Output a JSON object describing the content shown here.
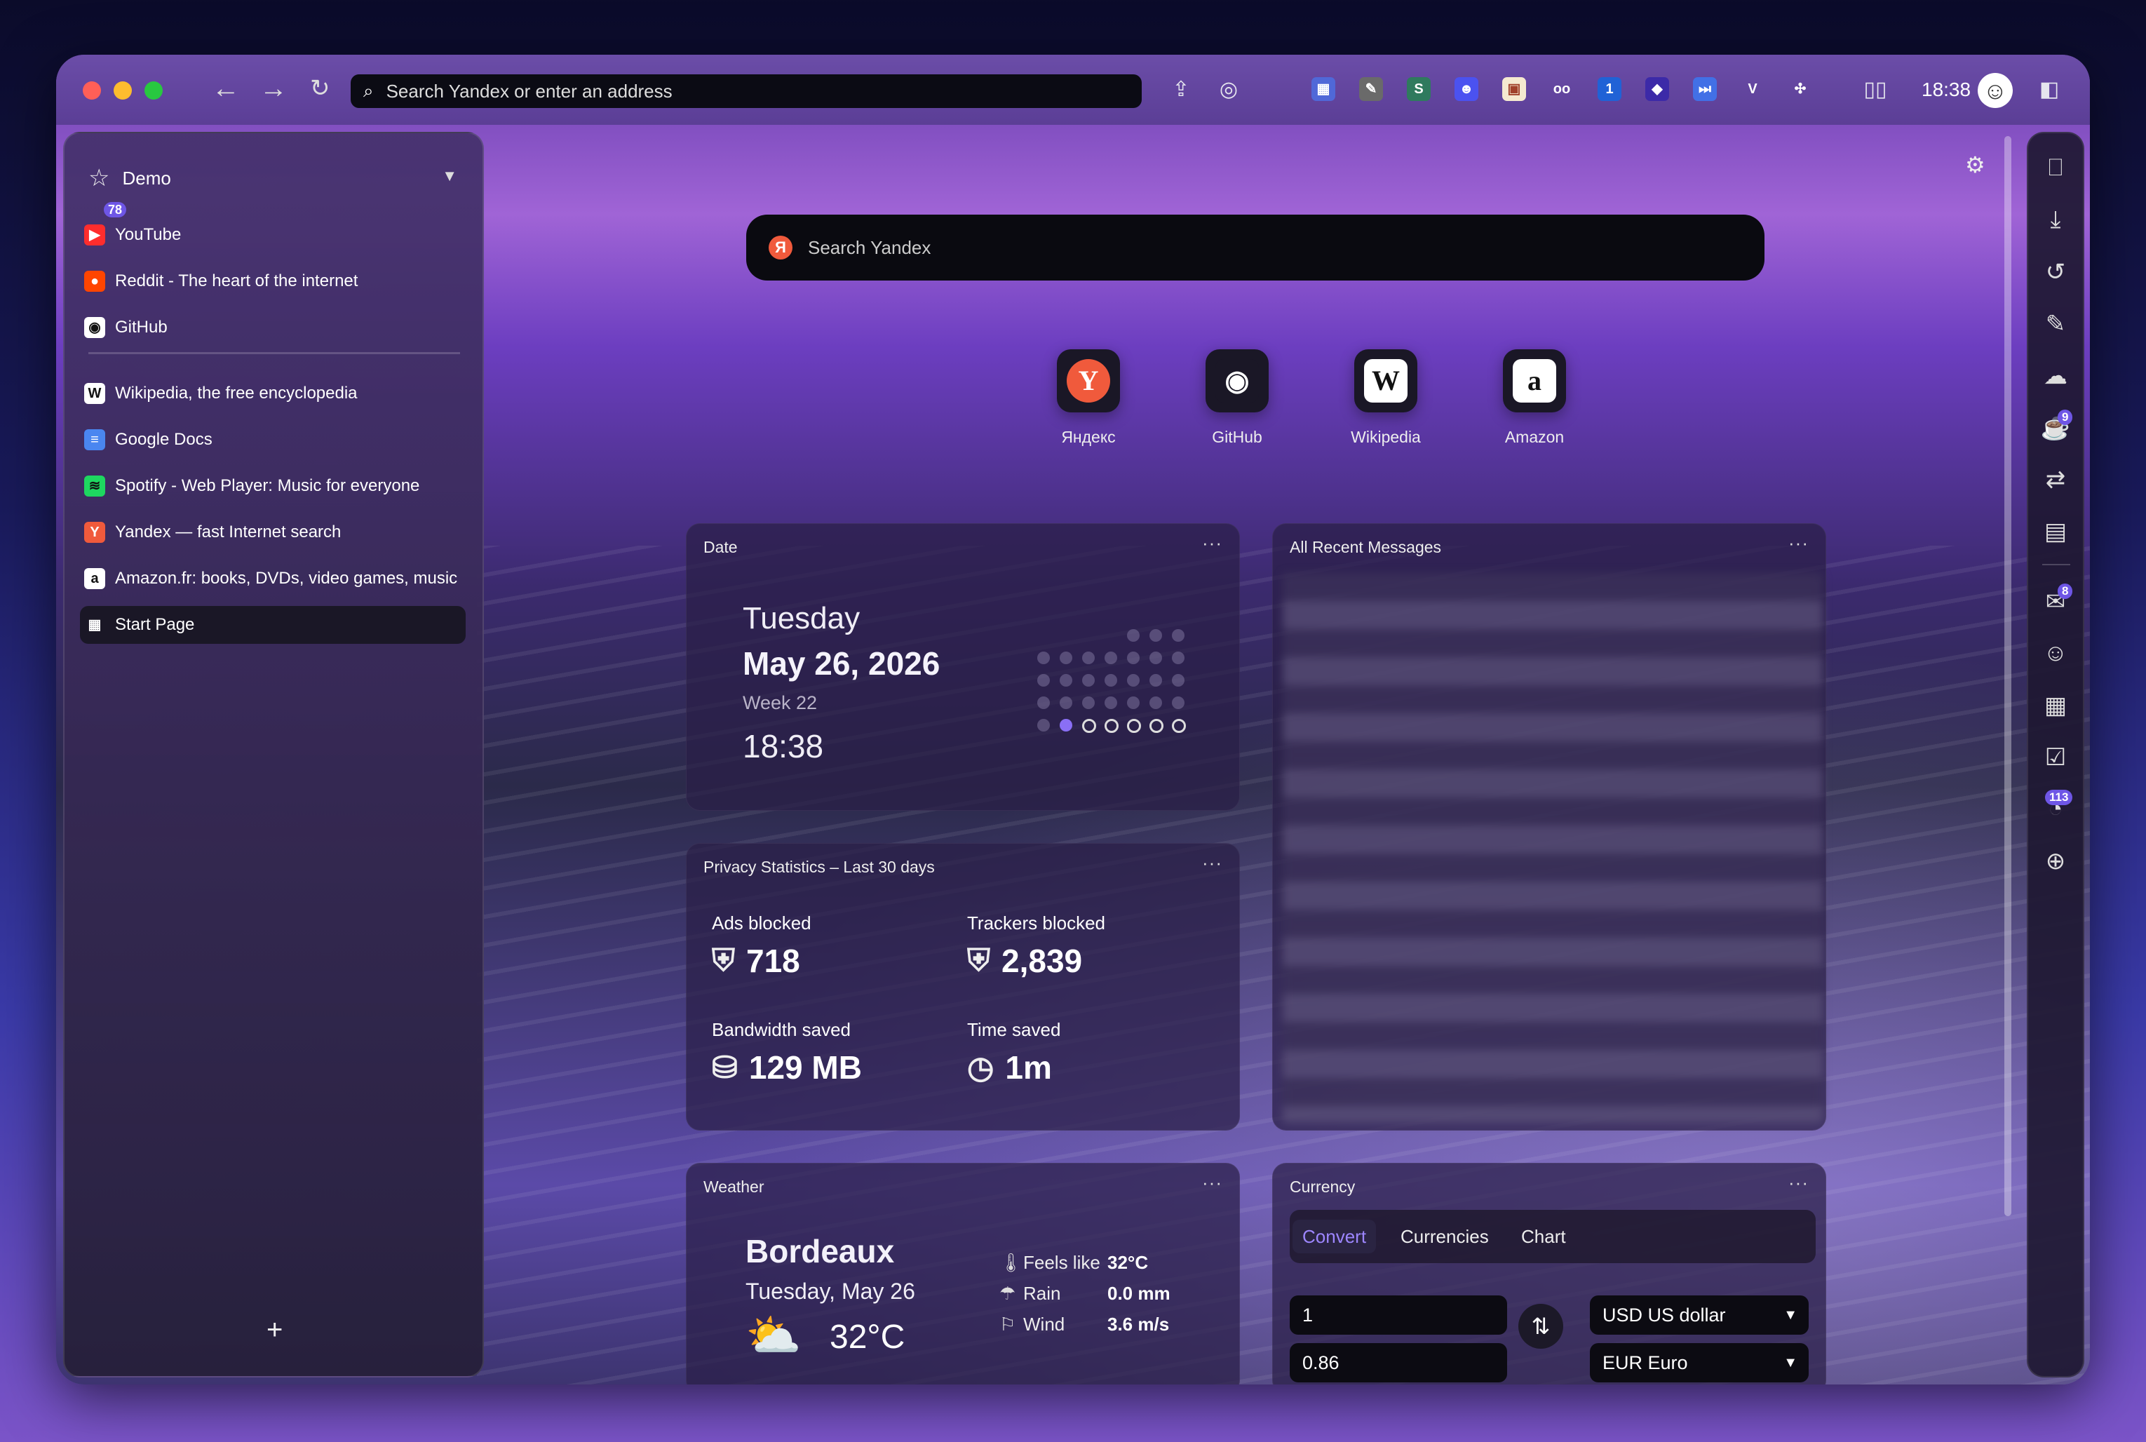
{
  "toolbar": {
    "address_placeholder": "Search Yandex or enter an address",
    "clock": "18:38",
    "extensions": [
      {
        "icon": "calendar-ext-icon",
        "glyph": "▦",
        "bg": "#5068d8"
      },
      {
        "icon": "feather-ext-icon",
        "glyph": "✎",
        "bg": "#6a6a6a"
      },
      {
        "icon": "s-ext-icon",
        "glyph": "S",
        "bg": "#2f7a5e"
      },
      {
        "icon": "chat-ext-icon",
        "glyph": "☻",
        "bg": "#4b52f0"
      },
      {
        "icon": "pixel-ext-icon",
        "glyph": "▣",
        "bg": "#f5e9d0"
      },
      {
        "icon": "glasses-ext-icon",
        "glyph": "oo",
        "bg": "transparent"
      },
      {
        "icon": "onepassword-ext-icon",
        "glyph": "1",
        "bg": "#2062d6"
      },
      {
        "icon": "diamond-ext-icon",
        "glyph": "◆",
        "bg": "#3c2aa8"
      },
      {
        "icon": "skip-ext-icon",
        "glyph": "⏭",
        "bg": "#4270e6"
      },
      {
        "icon": "vivaldi-ext-icon",
        "glyph": "V",
        "bg": "transparent"
      },
      {
        "icon": "puzzle-ext-icon",
        "glyph": "✣",
        "bg": "transparent"
      }
    ]
  },
  "left_panel": {
    "workspace": "Demo",
    "youtube_badge": "78",
    "pinned": [
      {
        "label": "YouTube",
        "icon": "youtube-icon",
        "color": "#ff2d2d",
        "glyph": "▶"
      },
      {
        "label": "Reddit - The heart of the internet",
        "icon": "reddit-icon",
        "color": "#ff4500",
        "glyph": "●"
      },
      {
        "label": "GitHub",
        "icon": "github-icon",
        "color": "#ffffff",
        "glyph": "◉"
      }
    ],
    "tabs": [
      {
        "label": "Wikipedia, the free encyclopedia",
        "icon": "wikipedia-icon",
        "color": "#ffffff",
        "glyph": "W"
      },
      {
        "label": "Google Docs",
        "icon": "google-docs-icon",
        "color": "#4a86f0",
        "glyph": "≡"
      },
      {
        "label": "Spotify - Web Player: Music for everyone",
        "icon": "spotify-icon",
        "color": "#1ed760",
        "glyph": "≋"
      },
      {
        "label": "Yandex — fast Internet search",
        "icon": "yandex-icon",
        "color": "#f05a3c",
        "glyph": "Y"
      },
      {
        "label": "Amazon.fr: books, DVDs, video games, music",
        "icon": "amazon-icon",
        "color": "#ffffff",
        "glyph": "a"
      },
      {
        "label": "Start Page",
        "icon": "grid-icon",
        "color": "transparent",
        "glyph": "▦"
      }
    ]
  },
  "search": {
    "placeholder": "Search Yandex",
    "logo": "Я"
  },
  "speed_dial": [
    {
      "label": "Яндекс",
      "icon": "yandex-tile-icon",
      "glyph": "Y"
    },
    {
      "label": "GitHub",
      "icon": "github-tile-icon",
      "glyph": "◉"
    },
    {
      "label": "Wikipedia",
      "icon": "wikipedia-tile-icon",
      "glyph": "W"
    },
    {
      "label": "Amazon",
      "icon": "amazon-tile-icon",
      "glyph": "a"
    }
  ],
  "date_widget": {
    "title": "Date",
    "day": "Tuesday",
    "date": "May 26, 2026",
    "week": "Week 22",
    "time": "18:38"
  },
  "privacy_widget": {
    "title": "Privacy Statistics – Last 30 days",
    "ads_label": "Ads blocked",
    "ads_value": "718",
    "trackers_label": "Trackers blocked",
    "trackers_value": "2,839",
    "bandwidth_label": "Bandwidth saved",
    "bandwidth_value": "129 MB",
    "time_label": "Time saved",
    "time_value": "1m"
  },
  "messages_widget": {
    "title": "All Recent Messages"
  },
  "weather_widget": {
    "title": "Weather",
    "city": "Bordeaux",
    "date": "Tuesday, May 26",
    "temp": "32°C",
    "feels_label": "Feels like",
    "feels_value": "32°C",
    "rain_label": "Rain",
    "rain_value": "0.0 mm",
    "wind_label": "Wind",
    "wind_value": "3.6 m/s"
  },
  "currency_widget": {
    "title": "Currency",
    "tabs": [
      "Convert",
      "Currencies",
      "Chart"
    ],
    "amount_from": "1",
    "amount_to": "0.86",
    "currency_from": "USD US dollar",
    "currency_to": "EUR Euro"
  },
  "right_bar": {
    "badges": {
      "reading": "9",
      "mail": "8",
      "feeds": "113"
    }
  },
  "menu_glyph": "···"
}
